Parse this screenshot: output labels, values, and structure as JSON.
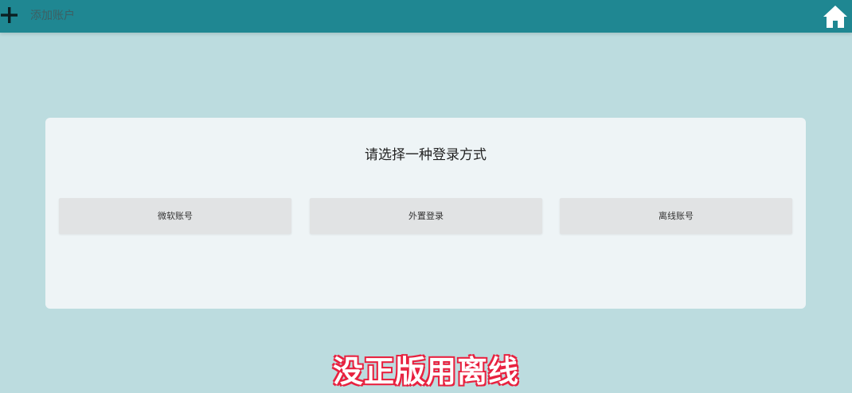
{
  "header": {
    "add_icon": "plus-icon",
    "title": "添加账户",
    "home_icon": "home-icon"
  },
  "login_panel": {
    "heading": "请选择一种登录方式",
    "options": [
      {
        "label": "微软账号"
      },
      {
        "label": "外置登录"
      },
      {
        "label": "离线账号"
      }
    ]
  },
  "caption": "没正版用离线",
  "colors": {
    "header_bg": "#1f8792",
    "page_bg": "#bcdcdf",
    "card_bg": "#eef4f6",
    "option_bg": "#e1e3e4",
    "caption_outline": "#e8213f"
  }
}
